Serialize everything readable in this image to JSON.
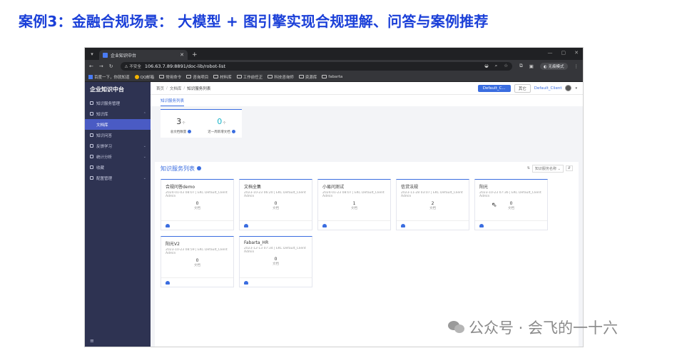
{
  "slide": {
    "title": "案例3：金融合规场景： 大模型 + 图引擎实现合规理解、问答与案例推荐"
  },
  "browser": {
    "tab_title": "企业知识中台",
    "url": "106.63.7.89:8891/doc-lib/robot-list",
    "insecure_label": "不安全",
    "incognito_label": "无痕模式",
    "bookmarks": [
      "百度一下，你就知道",
      "QQ邮箱",
      "常用命令",
      "咨询项目",
      "材料库",
      "工作前任正",
      "科技咨询师",
      "资源库",
      "fabarta"
    ]
  },
  "app": {
    "brand": "企业知识中台",
    "nav": [
      {
        "label": "知识服务管理",
        "icon": "service-icon"
      },
      {
        "label": "知识库",
        "icon": "library-icon"
      },
      {
        "label": "文档库",
        "icon": "",
        "sub": true,
        "active": true
      },
      {
        "label": "知识问答",
        "icon": "qa-icon"
      },
      {
        "label": "反馈学习",
        "icon": "feedback-icon"
      },
      {
        "label": "统计分析",
        "icon": "chart-icon"
      },
      {
        "label": "收藏",
        "icon": "star-icon"
      },
      {
        "label": "配置管理",
        "icon": "settings-icon"
      }
    ],
    "breadcrumb": [
      "首页",
      "文档库",
      "知识服务列表"
    ],
    "header": {
      "tenant_button": "Default_C...",
      "secondary_button": "其它",
      "user_name": "Default_Client"
    },
    "subtab": "知识服务列表",
    "stats": [
      {
        "value": "3",
        "unit": "个",
        "label": "总文档数量"
      },
      {
        "value": "0",
        "unit": "个",
        "label": "近一周新增文档"
      }
    ],
    "list": {
      "title": "知识服务列表",
      "sort_label": "知识服务名称",
      "cards": [
        {
          "title": "合规问答demo",
          "meta": "2024-01-03 08:07 | EKC Default_Client",
          "owner": "Admin",
          "count": "0",
          "unit": "文档"
        },
        {
          "title": "文档全集",
          "meta": "2023-10-23 06:20 | EKC Default_Client",
          "owner": "Admin",
          "count": "0",
          "unit": "文档"
        },
        {
          "title": "小易问测试",
          "meta": "2024-01-23 08:07 | EKC Default_Client",
          "owner": "Admin",
          "count": "1",
          "unit": "文档"
        },
        {
          "title": "信贷法规",
          "meta": "2023-11-28 03:07 | EKC Default_Client",
          "owner": "Admin",
          "count": "2",
          "unit": "文档"
        },
        {
          "title": "阳光",
          "meta": "2023-10-23 07:36 | EKC Default_Client",
          "owner": "Admin",
          "count": "0",
          "unit": "文档"
        },
        {
          "title": "阳光V2",
          "meta": "2023-10-23 08:59 | EKC Default_Client",
          "owner": "Admin",
          "count": "0",
          "unit": "文档"
        },
        {
          "title": "Fabarta_HR",
          "meta": "2023-12-13 07:34 | EKC Default_Client",
          "owner": "Admin",
          "count": "0",
          "unit": "文档"
        }
      ]
    }
  },
  "watermark": "公众号 · 会飞的一十六"
}
